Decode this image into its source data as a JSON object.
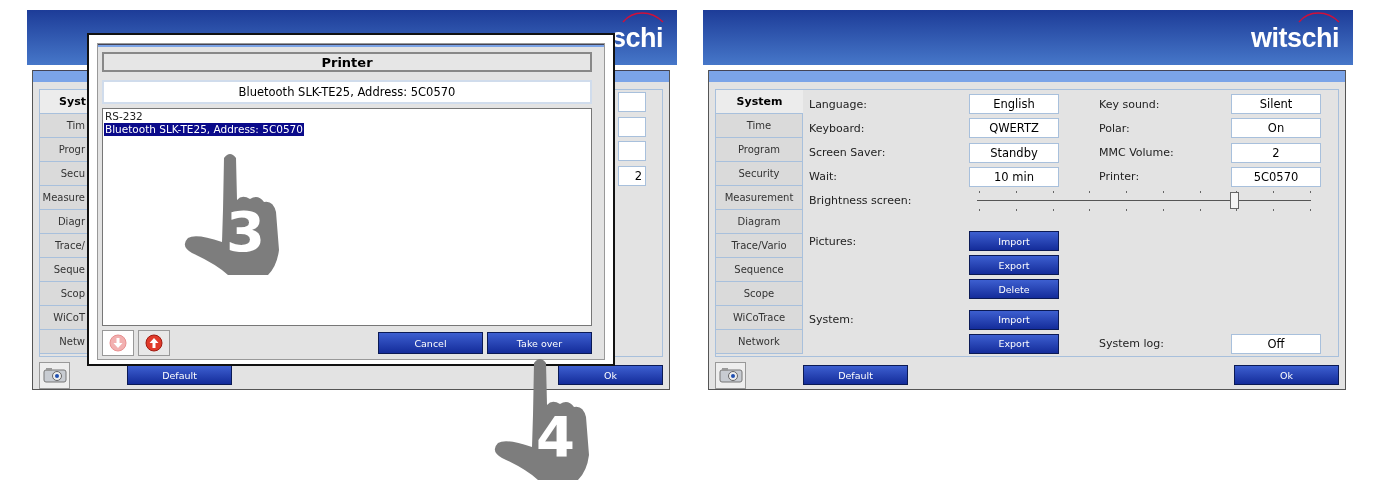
{
  "left_screen": {
    "logo": "schi",
    "tabs": [
      {
        "label": "Syst",
        "selected": true
      },
      {
        "label": "Tim",
        "selected": false
      },
      {
        "label": "Progr",
        "selected": false
      },
      {
        "label": "Secu",
        "selected": false
      },
      {
        "label": "Measure",
        "selected": false
      },
      {
        "label": "Diagr",
        "selected": false
      },
      {
        "label": "Trace/",
        "selected": false
      },
      {
        "label": "Seque",
        "selected": false
      },
      {
        "label": "Scop",
        "selected": false
      },
      {
        "label": "WiCoT",
        "selected": false
      },
      {
        "label": "Netw",
        "selected": false
      }
    ],
    "field_value": "2",
    "footer_buttons": [
      "Default",
      "Ok"
    ]
  },
  "printer_dialog": {
    "title": "Printer",
    "current": "Bluetooth SLK-TE25, Address: 5C0570",
    "items": [
      {
        "label": "RS-232",
        "selected": false
      },
      {
        "label": "Bluetooth SLK-TE25, Address: 5C0570",
        "selected": true
      }
    ],
    "move_down": {
      "disabled": true
    },
    "move_up": {
      "disabled": false
    },
    "buttons": [
      "Cancel",
      "Take over"
    ]
  },
  "steps": [
    {
      "number": "3"
    },
    {
      "number": "4"
    }
  ],
  "right_screen": {
    "logo": "witschi",
    "tabs": [
      {
        "label": "System",
        "selected": true
      },
      {
        "label": "Time",
        "selected": false
      },
      {
        "label": "Program",
        "selected": false
      },
      {
        "label": "Security",
        "selected": false
      },
      {
        "label": "Measurement",
        "selected": false
      },
      {
        "label": "Diagram",
        "selected": false
      },
      {
        "label": "Trace/Vario",
        "selected": false
      },
      {
        "label": "Sequence",
        "selected": false
      },
      {
        "label": "Scope",
        "selected": false
      },
      {
        "label": "WiCoTrace",
        "selected": false
      },
      {
        "label": "Network",
        "selected": false
      }
    ],
    "fields": [
      [
        {
          "label": "Language:",
          "value": "English"
        },
        {
          "label": "Key sound:",
          "value": "Silent"
        }
      ],
      [
        {
          "label": "Keyboard:",
          "value": "QWERTZ"
        },
        {
          "label": "Polar:",
          "value": "On"
        }
      ],
      [
        {
          "label": "Screen Saver:",
          "value": "Standby"
        },
        {
          "label": "MMC Volume:",
          "value": "2"
        }
      ],
      [
        {
          "label": "Wait:",
          "value": "10 min"
        },
        {
          "label": "Printer:",
          "value": "5C0570"
        }
      ]
    ],
    "brightness": {
      "label": "Brightness screen:",
      "level": 0.77
    },
    "groups": [
      {
        "label": "Pictures:",
        "buttons": [
          "Import",
          "Export",
          "Delete"
        ]
      },
      {
        "label": "System:",
        "buttons": [
          "Import",
          "Export"
        ]
      }
    ],
    "system_log": {
      "label": "System log:",
      "value": "Off"
    },
    "footer_buttons": [
      "Default",
      "Ok"
    ]
  }
}
